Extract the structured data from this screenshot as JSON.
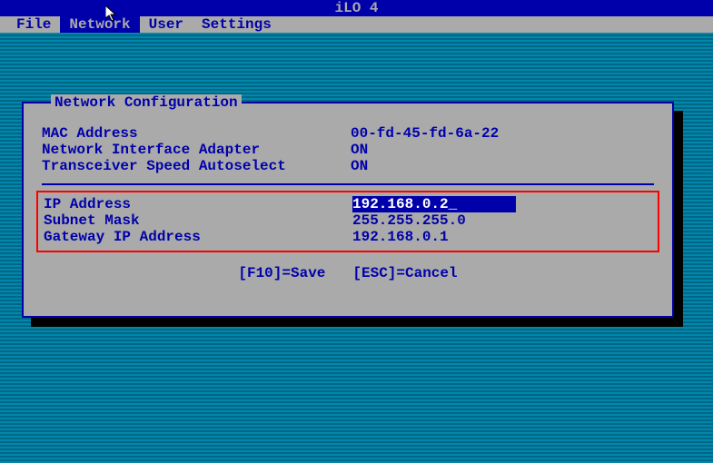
{
  "title": "iLO 4",
  "menu": {
    "file": "File",
    "network": "Network",
    "user": "User",
    "settings": "Settings"
  },
  "dialog": {
    "title": "Network Configuration",
    "mac_label": "MAC Address",
    "mac_value": "00-fd-45-fd-6a-22",
    "nic_label": "Network Interface Adapter",
    "nic_value": "ON",
    "speed_label": "Transceiver Speed Autoselect",
    "speed_value": "ON",
    "ip_label": "IP Address",
    "ip_value": "192.168.0.2",
    "subnet_label": "Subnet Mask",
    "subnet_value": "255.255.255.0",
    "gateway_label": "Gateway IP Address",
    "gateway_value": "192.168.0.1",
    "save_hint": "[F10]=Save",
    "cancel_hint": "[ESC]=Cancel"
  }
}
